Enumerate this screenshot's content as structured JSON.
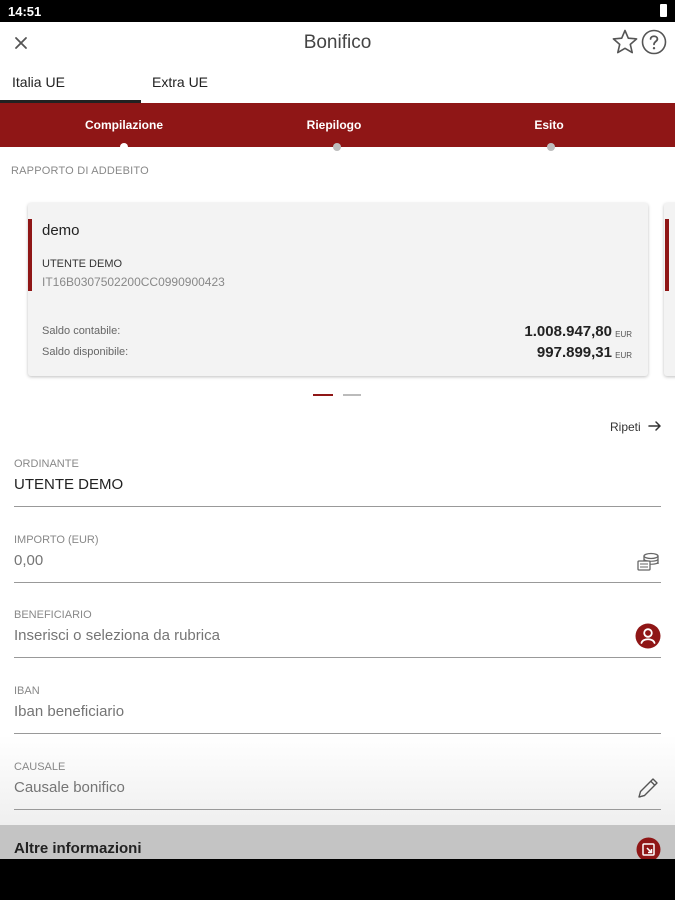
{
  "status_bar": {
    "time": "14:51"
  },
  "header": {
    "title": "Bonifico"
  },
  "tabs": [
    {
      "label": "Italia UE",
      "active": true
    },
    {
      "label": "Extra UE",
      "active": false
    }
  ],
  "steps": [
    {
      "label": "Compilazione",
      "active": true
    },
    {
      "label": "Riepilogo",
      "active": false
    },
    {
      "label": "Esito",
      "active": false
    }
  ],
  "section": {
    "debit_account_label": "RAPPORTO DI ADDEBITO"
  },
  "account_card": {
    "name": "demo",
    "holder": "UTENTE DEMO",
    "iban": "IT16B0307502200CC0990900423",
    "saldo_contabile_label": "Saldo contabile:",
    "saldo_contabile_value": "1.008.947,80",
    "saldo_disponibile_label": "Saldo disponibile:",
    "saldo_disponibile_value": "997.899,31",
    "currency": "EUR"
  },
  "carousel": {
    "page": 1,
    "pages": 2
  },
  "repeat": {
    "label": "Ripeti"
  },
  "form": {
    "ordinante": {
      "label": "ORDINANTE",
      "value": "UTENTE DEMO"
    },
    "importo": {
      "label": "IMPORTO (EUR)",
      "value": "0,00"
    },
    "beneficiario": {
      "label": "BENEFICIARIO",
      "placeholder": "Inserisci o seleziona da rubrica"
    },
    "iban": {
      "label": "IBAN",
      "placeholder": "Iban beneficiario"
    },
    "causale": {
      "label": "CAUSALE",
      "placeholder": "Causale bonifico"
    }
  },
  "more_info": {
    "label": "Altre informazioni"
  },
  "colors": {
    "brand": "#8f1616",
    "stepper_bg": "#8f1616",
    "more_bar_bg": "#c4c4c4"
  },
  "icons": [
    "close-icon",
    "star-icon",
    "help-icon",
    "arrow-right-icon",
    "coins-icon",
    "contact-book-icon",
    "pencil-icon",
    "expand-icon",
    "battery-icon"
  ]
}
